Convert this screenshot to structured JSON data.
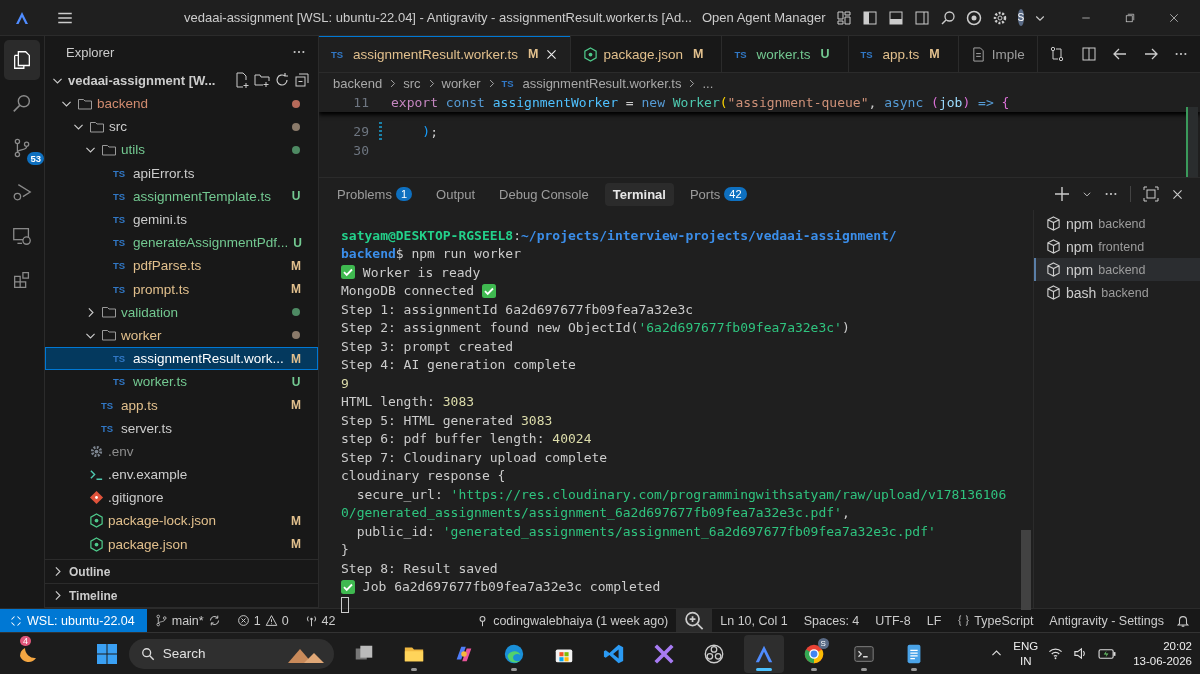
{
  "title_bar": {
    "title": "vedaai-assignment [WSL: ubuntu-22.04] - Antigravity - assignmentResult.worker.ts [Ad...",
    "agent_manager": "Open Agent Manager",
    "avatar": "S"
  },
  "activity_bar": [
    {
      "kind": "explorer",
      "selected": true
    },
    {
      "kind": "search",
      "selected": false
    },
    {
      "kind": "source-control",
      "selected": false,
      "badge": "53"
    },
    {
      "kind": "run-debug",
      "selected": false
    },
    {
      "kind": "remote",
      "selected": false
    },
    {
      "kind": "extensions",
      "selected": false
    }
  ],
  "explorer": {
    "title": "Explorer",
    "workspace": "vedaai-assignment [W...",
    "tree": [
      {
        "name": "backend",
        "kind": "folder",
        "expanded": true,
        "selected": false,
        "color": "#d18b6f",
        "dot": {
          "color": "#b66a5a"
        },
        "children": [
          {
            "name": "src",
            "kind": "folder",
            "expanded": true,
            "selected": false,
            "color": "#cccccc",
            "dot": {
              "color": "#8a7a6a"
            },
            "children": [
              {
                "name": "utils",
                "kind": "folder",
                "expanded": true,
                "selected": false,
                "color": "#73c991",
                "dot": {
                  "color": "#4e8a63"
                },
                "children": [
                  {
                    "name": "apiError.ts",
                    "kind": "ts",
                    "icon_label": "TS",
                    "selected": false,
                    "color": "#cccccc"
                  },
                  {
                    "name": "assignmentTemplate.ts",
                    "kind": "ts",
                    "icon_label": "TS",
                    "selected": false,
                    "color": "#73c991",
                    "badge": "U"
                  },
                  {
                    "name": "gemini.ts",
                    "kind": "ts",
                    "icon_label": "TS",
                    "selected": false,
                    "color": "#cccccc"
                  },
                  {
                    "name": "generateAssignmentPdf...",
                    "kind": "ts",
                    "icon_label": "TS",
                    "selected": false,
                    "color": "#73c991",
                    "badge": "U"
                  },
                  {
                    "name": "pdfParse.ts",
                    "kind": "ts",
                    "icon_label": "TS",
                    "selected": false,
                    "color": "#e2c08d",
                    "badge": "M"
                  },
                  {
                    "name": "prompt.ts",
                    "kind": "ts",
                    "icon_label": "TS",
                    "selected": false,
                    "color": "#e2c08d",
                    "badge": "M"
                  }
                ]
              },
              {
                "name": "validation",
                "kind": "folder",
                "expanded": false,
                "selected": false,
                "color": "#73c991",
                "dot": {
                  "color": "#4e8a63"
                }
              },
              {
                "name": "worker",
                "kind": "folder",
                "expanded": true,
                "selected": false,
                "color": "#e2c08d",
                "dot": {
                  "color": "#8a7a6a"
                },
                "children": [
                  {
                    "name": "assignmentResult.work...",
                    "kind": "ts",
                    "icon_label": "TS",
                    "selected": true,
                    "color": "#ffffff",
                    "badge": "M"
                  },
                  {
                    "name": "worker.ts",
                    "kind": "ts",
                    "icon_label": "TS",
                    "selected": false,
                    "color": "#73c991",
                    "badge": "U"
                  }
                ]
              },
              {
                "name": "app.ts",
                "kind": "ts",
                "icon_label": "TS",
                "selected": false,
                "color": "#e2c08d",
                "badge": "M"
              },
              {
                "name": "server.ts",
                "kind": "ts",
                "icon_label": "TS",
                "selected": false,
                "color": "#cccccc"
              }
            ]
          },
          {
            "name": ".env",
            "kind": "env",
            "selected": false,
            "color": "#8c8c8c"
          },
          {
            "name": ".env.example",
            "kind": "shell",
            "selected": false,
            "color": "#cccccc"
          },
          {
            "name": ".gitignore",
            "kind": "git",
            "selected": false,
            "color": "#cccccc"
          },
          {
            "name": "package-lock.json",
            "kind": "json",
            "selected": false,
            "color": "#e2c08d",
            "badge": "M"
          },
          {
            "name": "package.json",
            "kind": "json",
            "selected": false,
            "color": "#e2c08d",
            "badge": "M"
          }
        ]
      }
    ],
    "sections": [
      {
        "label": "Outline",
        "expanded": false
      },
      {
        "label": "Timeline",
        "expanded": false
      }
    ]
  },
  "editor": {
    "tabs": [
      {
        "label": "assignmentResult.worker.ts",
        "kind": "ts",
        "icon_label": "TS",
        "badge": "M",
        "color": "#e2c08d",
        "selected": true
      },
      {
        "label": "package.json",
        "kind": "json",
        "badge": "M",
        "color": "#e2c08d",
        "selected": false
      },
      {
        "label": "worker.ts",
        "kind": "ts",
        "icon_label": "TS",
        "badge": "U",
        "color": "#73c991",
        "selected": false
      },
      {
        "label": "app.ts",
        "kind": "ts",
        "icon_label": "TS",
        "badge": "M",
        "color": "#e2c08d",
        "selected": false
      },
      {
        "label": "Imple",
        "kind": "doc",
        "color": "#9d9d9d",
        "selected": false
      }
    ],
    "breadcrumb": [
      {
        "label": "backend"
      },
      {
        "label": "src"
      },
      {
        "label": "worker"
      },
      {
        "label": "assignmentResult.worker.ts",
        "icon_label": "TS"
      },
      {
        "label": "..."
      }
    ],
    "sticky_line": {
      "number": "11",
      "tokens": [
        {
          "kind": "keyword",
          "text": "export "
        },
        {
          "kind": "storage",
          "text": "const "
        },
        {
          "kind": "variable",
          "text": "assignmentWorker"
        },
        {
          "kind": "plain",
          "text": " = "
        },
        {
          "kind": "storage",
          "text": "new "
        },
        {
          "kind": "class",
          "text": "Worker"
        },
        {
          "kind": "bracket1",
          "text": "("
        },
        {
          "kind": "string",
          "text": "\"assignment-queue\""
        },
        {
          "kind": "plain",
          "text": ", "
        },
        {
          "kind": "storage",
          "text": "async "
        },
        {
          "kind": "bracket2",
          "text": "("
        },
        {
          "kind": "param",
          "text": "job"
        },
        {
          "kind": "bracket2",
          "text": ") "
        },
        {
          "kind": "storage",
          "text": "=> "
        },
        {
          "kind": "bracket2",
          "text": "{"
        }
      ]
    },
    "lines": [
      {
        "number": "29",
        "modified": true,
        "tokens": [
          {
            "kind": "bracket3",
            "text": "    )"
          },
          {
            "kind": "plain",
            "text": ";"
          }
        ]
      },
      {
        "number": "30",
        "modified": false
      }
    ]
  },
  "panel": {
    "tabs": [
      {
        "label": "Problems",
        "badge": "1",
        "selected": false
      },
      {
        "label": "Output",
        "selected": false
      },
      {
        "label": "Debug Console",
        "selected": false
      },
      {
        "label": "Terminal",
        "selected": true
      },
      {
        "label": "Ports",
        "badge": "42",
        "selected": false
      }
    ],
    "terminal": [
      {
        "segments": [
          {
            "kind": "user",
            "text": "satyam@DESKTOP-RGSEEL8"
          },
          {
            "kind": "plain",
            "text": ":"
          },
          {
            "kind": "path",
            "text": "~/projects/interview-projects/vedaai-assignment/"
          }
        ]
      },
      {
        "segments": [
          {
            "kind": "path",
            "text": "backend"
          },
          {
            "kind": "plain",
            "text": "$ npm run worker"
          }
        ]
      },
      {
        "segments": [
          {
            "kind": "check"
          },
          {
            "kind": "plain",
            "text": " Worker is ready"
          }
        ]
      },
      {
        "segments": [
          {
            "kind": "plain",
            "text": "MongoDB connected "
          },
          {
            "kind": "check"
          }
        ]
      },
      {
        "segments": [
          {
            "kind": "plain",
            "text": "Step 1: assignmentId 6a2d697677fb09fea7a32e3c"
          }
        ]
      },
      {
        "segments": [
          {
            "kind": "plain",
            "text": "Step 2: assignment found new ObjectId("
          },
          {
            "kind": "string",
            "text": "'6a2d697677fb09fea7a32e3c'"
          },
          {
            "kind": "plain",
            "text": ")"
          }
        ]
      },
      {
        "segments": [
          {
            "kind": "plain",
            "text": "Step 3: prompt created"
          }
        ]
      },
      {
        "segments": [
          {
            "kind": "plain",
            "text": "Step 4: AI generation complete"
          }
        ]
      },
      {
        "segments": [
          {
            "kind": "number",
            "text": "9"
          }
        ]
      },
      {
        "segments": [
          {
            "kind": "plain",
            "text": "HTML length: "
          },
          {
            "kind": "number",
            "text": "3083"
          }
        ]
      },
      {
        "segments": [
          {
            "kind": "plain",
            "text": "Step 5: HTML generated "
          },
          {
            "kind": "number",
            "text": "3083"
          }
        ]
      },
      {
        "segments": [
          {
            "kind": "plain",
            "text": "step 6: pdf buffer length: "
          },
          {
            "kind": "number",
            "text": "40024"
          }
        ]
      },
      {
        "segments": [
          {
            "kind": "plain",
            "text": "Step 7: Cloudinary upload complete"
          }
        ]
      },
      {
        "segments": [
          {
            "kind": "plain",
            "text": "cloudinary response {"
          }
        ]
      },
      {
        "segments": [
          {
            "kind": "plain",
            "text": "  secure_url: "
          },
          {
            "kind": "string",
            "text": "'https://res.cloudinary.com/programmingwithsatyam/raw/upload/v178136106"
          }
        ]
      },
      {
        "segments": [
          {
            "kind": "string",
            "text": "0/generated_assignments/assignment_6a2d697677fb09fea7a32e3c.pdf'"
          },
          {
            "kind": "plain",
            "text": ","
          }
        ]
      },
      {
        "segments": [
          {
            "kind": "plain",
            "text": "  public_id: "
          },
          {
            "kind": "string",
            "text": "'generated_assignments/assignment_6a2d697677fb09fea7a32e3c.pdf'"
          }
        ]
      },
      {
        "segments": [
          {
            "kind": "plain",
            "text": "}"
          }
        ]
      },
      {
        "segments": [
          {
            "kind": "plain",
            "text": "Step 8: Result saved"
          }
        ]
      },
      {
        "segments": [
          {
            "kind": "check"
          },
          {
            "kind": "plain",
            "text": " Job 6a2d697677fb09fea7a32e3c completed"
          }
        ]
      },
      {
        "segments": [
          {
            "kind": "cursor"
          }
        ]
      }
    ],
    "sessions": [
      {
        "name": "npm",
        "dir": "backend",
        "selected": false
      },
      {
        "name": "npm",
        "dir": "frontend",
        "selected": false
      },
      {
        "name": "npm",
        "dir": "backend",
        "selected": true
      },
      {
        "name": "bash",
        "dir": "backend",
        "selected": false
      }
    ]
  },
  "status_bar": {
    "remote": "WSL: ubuntu-22.04",
    "branch": "main*",
    "errors": "1",
    "warnings": "0",
    "ports": "42",
    "blame": "codingwalebhaiya (1 week ago)",
    "position": "Ln 10, Col 1",
    "indent": "Spaces: 4",
    "encoding": "UTF-8",
    "eol": "LF",
    "language": "TypeScript",
    "settings": "Antigravity - Settings"
  },
  "taskbar": {
    "weather_badge": "4",
    "search": "Search",
    "apps": [
      {
        "kind": "task-view",
        "running": false,
        "selected": false
      },
      {
        "kind": "folder",
        "running": true,
        "selected": false
      },
      {
        "kind": "copilot",
        "running": false,
        "selected": false
      },
      {
        "kind": "edge",
        "running": true,
        "selected": false
      },
      {
        "kind": "store",
        "running": false,
        "selected": false
      },
      {
        "kind": "vscode",
        "running": false,
        "selected": false
      },
      {
        "kind": "tool",
        "running": false,
        "selected": false
      },
      {
        "kind": "obs",
        "running": false,
        "selected": false
      },
      {
        "kind": "antigravity",
        "running": true,
        "selected": true
      },
      {
        "kind": "chrome",
        "running": true,
        "selected": false,
        "badge": "S"
      },
      {
        "kind": "terminal",
        "running": true,
        "selected": false
      },
      {
        "kind": "notepad",
        "running": true,
        "selected": false
      }
    ],
    "language": "ENG",
    "region": "IN",
    "time": "20:02",
    "date": "13-06-2026"
  }
}
